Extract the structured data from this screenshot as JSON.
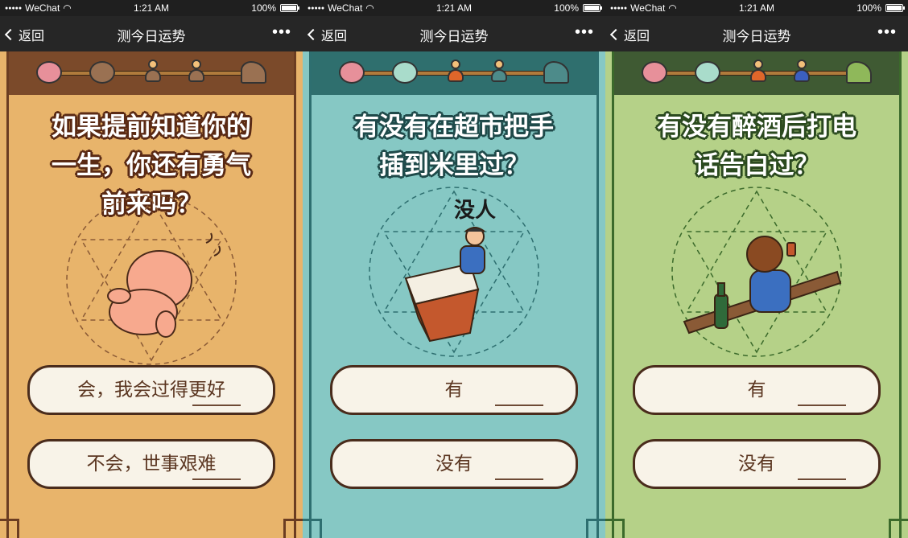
{
  "screens": [
    {
      "status": {
        "carrier": "WeChat",
        "time": "1:21 AM",
        "battery": "100%"
      },
      "nav": {
        "back": "返回",
        "title": "测今日运势",
        "more": "•••"
      },
      "question_lines": [
        "如果提前知道你的",
        "一生，你还有勇气",
        "前来吗？"
      ],
      "buttons": [
        "会，我会过得更好",
        "不会，世事艰难"
      ],
      "colors": {
        "bg": "#e8b46b",
        "frame": "#6b3d22",
        "banner": "#7b4a2a",
        "text_outline": "#5a2a14"
      }
    },
    {
      "status": {
        "carrier": "WeChat",
        "time": "1:21 AM",
        "battery": "100%"
      },
      "nav": {
        "back": "返回",
        "title": "测今日运势",
        "more": "•••"
      },
      "question_lines": [
        "有没有在超市把手",
        "插到米里过？"
      ],
      "illustration_text": "没人",
      "buttons": [
        "有",
        "没有"
      ],
      "colors": {
        "bg": "#86c8c4",
        "frame": "#2e6f70",
        "banner": "#2f6f6e",
        "text_outline": "#1f4a4a"
      }
    },
    {
      "status": {
        "carrier": "WeChat",
        "time": "1:21 AM",
        "battery": "100%"
      },
      "nav": {
        "back": "返回",
        "title": "测今日运势",
        "more": "•••"
      },
      "question_lines": [
        "有没有醉酒后打电",
        "话告白过？"
      ],
      "buttons": [
        "有",
        "没有"
      ],
      "colors": {
        "bg": "#b5d188",
        "frame": "#3b6a2b",
        "banner": "#3f5a33",
        "text_outline": "#2b4a1f"
      }
    }
  ]
}
